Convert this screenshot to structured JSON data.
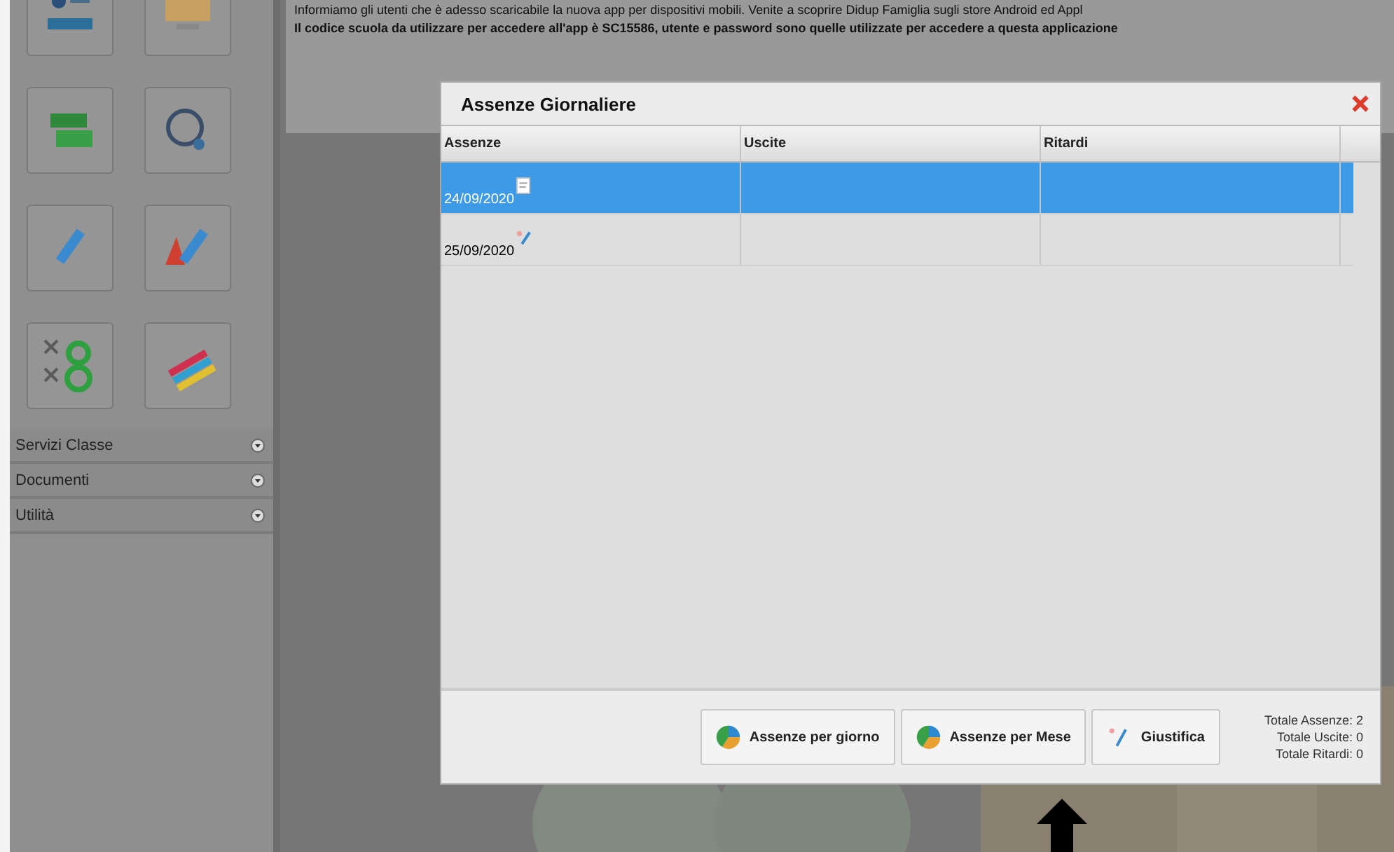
{
  "notice": {
    "lines": [
      {
        "text": "Informiamo gli utenti che è adesso scaricabile la nuova app per dispositivi mobili. Venite a scoprire Didup Famiglia sugli store Android ed Appl",
        "bold": false
      },
      {
        "text": "Il codice scuola da utilizzare per accedere all'app è SC15586, utente e password sono quelle utilizzate per accedere a questa applicazione",
        "bold": true
      }
    ]
  },
  "sidebar": {
    "sections": [
      {
        "label": "Servizi Classe"
      },
      {
        "label": "Documenti"
      },
      {
        "label": "Utilità"
      }
    ]
  },
  "dialog": {
    "title": "Assenze Giornaliere",
    "table": {
      "columns": [
        "Assenze",
        "Uscite",
        "Ritardi"
      ],
      "rows": [
        {
          "cells": [
            "24/09/2020",
            "",
            ""
          ],
          "kind": "note",
          "selected": true
        },
        {
          "cells": [
            "25/09/2020",
            "",
            ""
          ],
          "kind": "justify",
          "selected": false
        }
      ]
    },
    "buttons": [
      {
        "label": "Assenze per giorno",
        "kind": "chart"
      },
      {
        "label": "Assenze per Mese",
        "kind": "chart"
      },
      {
        "label": "Giustifica",
        "kind": "justify"
      }
    ],
    "totals": [
      "Totale Assenze: 2",
      "Totale Uscite: 0",
      "Totale Ritardi: 0"
    ]
  }
}
